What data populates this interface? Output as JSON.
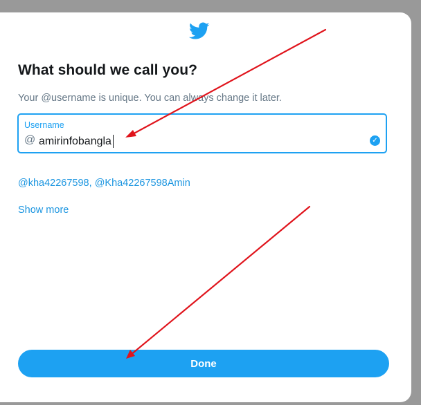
{
  "modal": {
    "logo_icon": "twitter-bird-icon",
    "title": "What should we call you?",
    "subtitle": "Your @username is unique. You can always change it later."
  },
  "username_field": {
    "label": "Username",
    "prefix": "@",
    "value": "amirinfobangla",
    "status_icon": "check-circle-icon",
    "focused": true
  },
  "suggestions": {
    "items": [
      "@kha42267598",
      "@Kha42267598Amin"
    ],
    "separator": ", "
  },
  "show_more_label": "Show more",
  "done_button_label": "Done",
  "colors": {
    "accent": "#1da1f2",
    "link": "#1b95e0",
    "title_text": "#14171a",
    "muted_text": "#657786",
    "backdrop": "#999999",
    "annotation_arrow": "#e0141c"
  },
  "annotations": {
    "arrow_count": 2,
    "arrow_icon": "red-arrow-annotation"
  }
}
